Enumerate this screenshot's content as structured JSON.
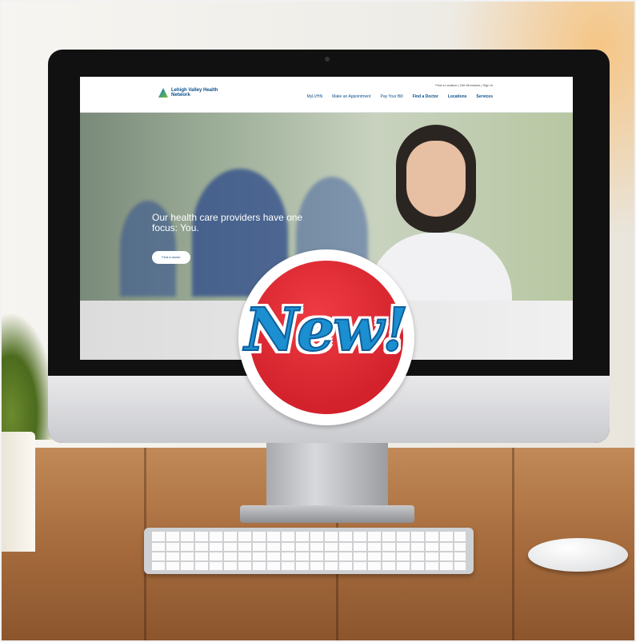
{
  "site": {
    "logo_text": "Lehigh Valley Health Network",
    "utility_text": "Find a Location | Get Directions | Sign In",
    "nav": [
      {
        "label": "MyLVHN",
        "bold": false
      },
      {
        "label": "Make an Appointment",
        "bold": false
      },
      {
        "label": "Pay Your Bill",
        "bold": false
      },
      {
        "label": "Find a Doctor",
        "bold": true
      },
      {
        "label": "Locations",
        "bold": true
      },
      {
        "label": "Services",
        "bold": true
      }
    ],
    "hero_headline": "Our health care providers have one focus: You.",
    "hero_button": "Find a doctor"
  },
  "badge": {
    "text": "New!",
    "colors": {
      "red": "#d3222c",
      "blue": "#1b8fd0",
      "white": "#ffffff"
    }
  }
}
